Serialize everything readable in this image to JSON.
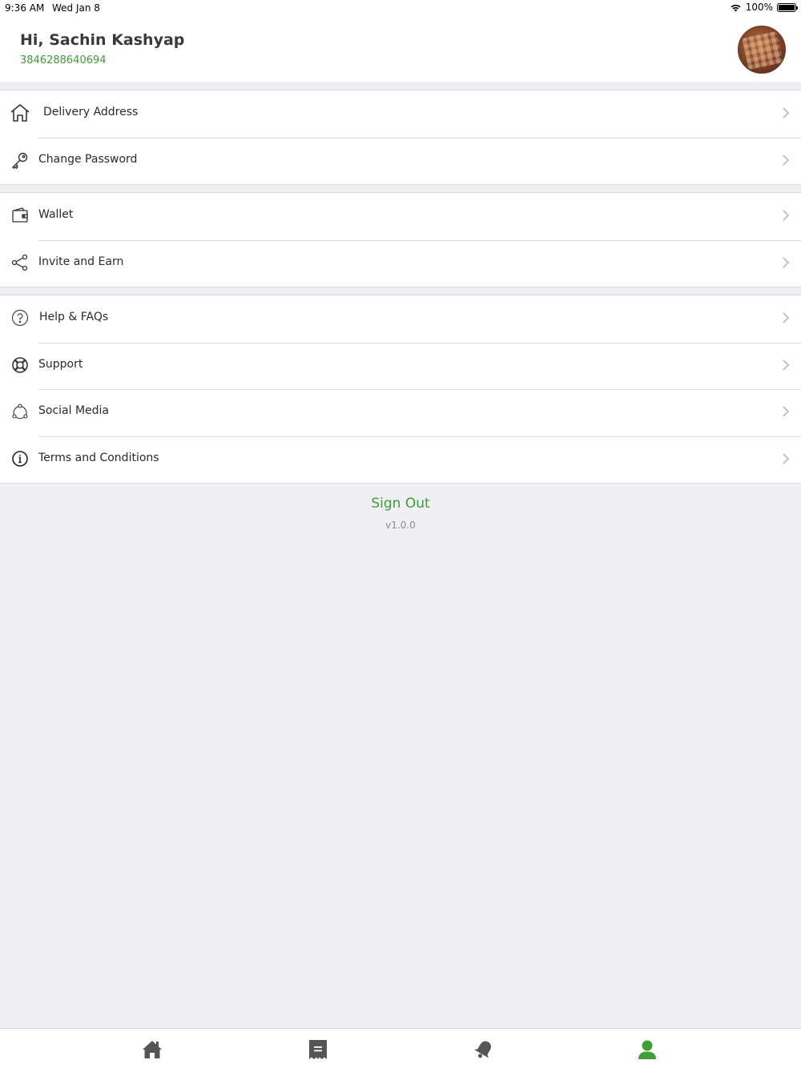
{
  "status_bar": {
    "time": "9:36 AM",
    "date": "Wed Jan 8",
    "battery": "100%",
    "battery_level": 1.0
  },
  "profile": {
    "greeting": "Hi, Sachin Kashyap",
    "phone": "3846288640694"
  },
  "sections": [
    {
      "items": [
        {
          "label": "Delivery Address",
          "icon": "home-outline-icon"
        },
        {
          "label": "Change Password",
          "icon": "key-icon"
        }
      ]
    },
    {
      "items": [
        {
          "label": "Wallet",
          "icon": "wallet-icon"
        },
        {
          "label": "Invite and Earn",
          "icon": "share-icon"
        }
      ]
    },
    {
      "items": [
        {
          "label": "Help & FAQs",
          "icon": "question-circle-icon"
        },
        {
          "label": "Support",
          "icon": "lifebuoy-icon"
        },
        {
          "label": "Social Media",
          "icon": "social-network-icon"
        },
        {
          "label": "Terms and Conditions",
          "icon": "info-circle-icon"
        }
      ]
    }
  ],
  "footer": {
    "sign_out": "Sign Out",
    "version": "v1.0.0"
  },
  "tab_bar": {
    "tabs": [
      {
        "icon": "home-icon",
        "active": false
      },
      {
        "icon": "receipt-icon",
        "active": false
      },
      {
        "icon": "bell-icon",
        "active": false
      },
      {
        "icon": "profile-icon",
        "active": true
      }
    ]
  },
  "colors": {
    "accent": "#3aa135",
    "background": "#efeff4",
    "icon_inactive": "#555555"
  }
}
